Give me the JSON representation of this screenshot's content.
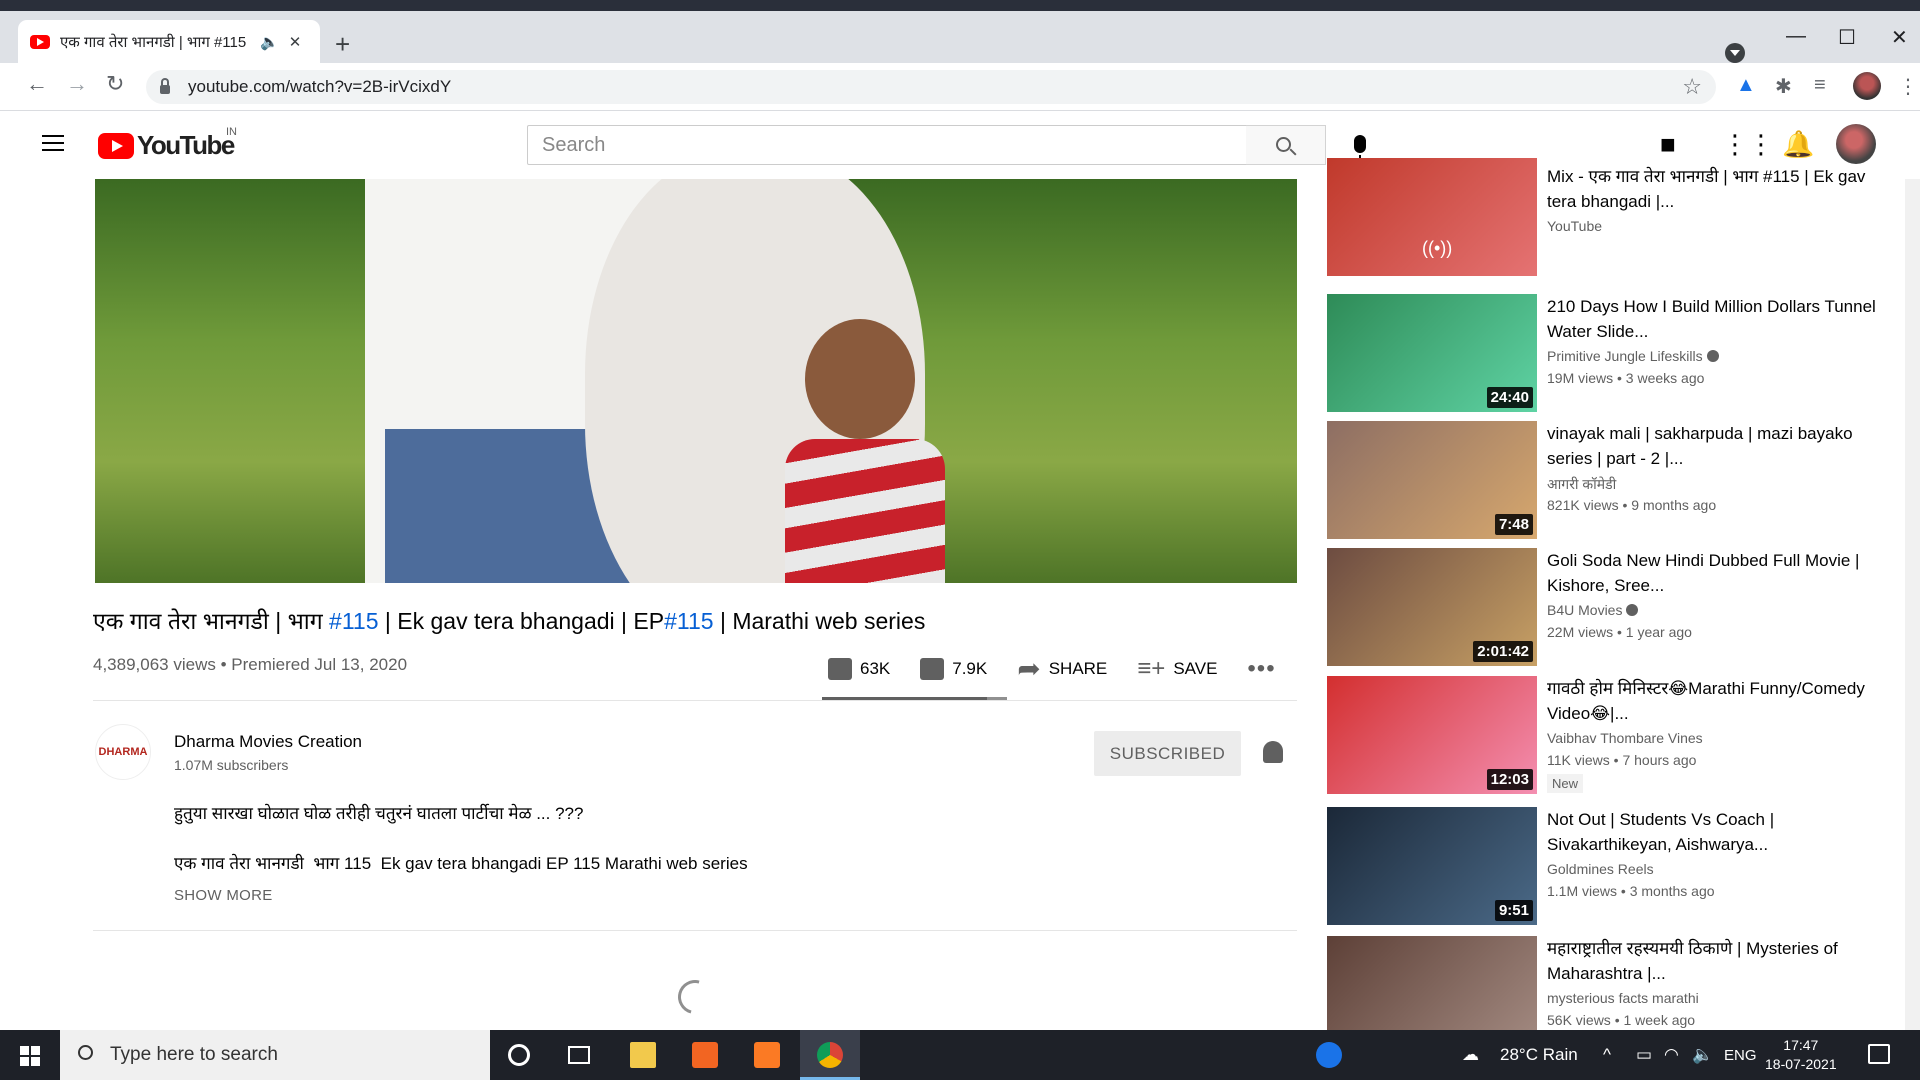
{
  "browser": {
    "tab_title": "एक गाव तेरा भानगडी | भाग #115",
    "url": "youtube.com/watch?v=2B-irVcixdY"
  },
  "youtube": {
    "logo_text": "YouTube",
    "country_code": "IN",
    "search_placeholder": "Search"
  },
  "video": {
    "title_part1": "एक गाव तेरा भानगडी | भाग ",
    "title_tag1": "#115",
    "title_part2": " | Ek gav tera bhangadi | EP",
    "title_tag2": "#115",
    "title_part3": " | Marathi web series",
    "views_date": "4,389,063 views • Premiered Jul 13, 2020",
    "likes": "63K",
    "dislikes": "7.9K",
    "share_label": "SHARE",
    "save_label": "SAVE",
    "like_ratio": 0.89
  },
  "channel": {
    "name": "Dharma Movies Creation",
    "subscribers": "1.07M subscribers",
    "subscribe_label": "SUBSCRIBED",
    "avatar_text": "DHARMA"
  },
  "description": {
    "line1": "हुतुया सारखा घोळात घोळ तरीही चतुरनं घातला पार्टीचा मेळ ... ???",
    "line2": "एक गाव तेरा भानगडी  भाग 115  Ek gav tera bhangadi EP 115 Marathi web series",
    "show_more": "SHOW MORE"
  },
  "recommendations": [
    {
      "title": "Mix - एक गाव तेरा भानगडी | भाग #115 | Ek gav tera bhangadi |...",
      "channel": "YouTube",
      "stats": "",
      "duration": "",
      "verified": false,
      "new": false
    },
    {
      "title": "210 Days How I Build Million Dollars Tunnel Water Slide...",
      "channel": "Primitive Jungle Lifeskills",
      "stats": "19M views • 3 weeks ago",
      "duration": "24:40",
      "verified": true,
      "new": false
    },
    {
      "title": "vinayak mali | sakharpuda | mazi bayako series | part - 2 |...",
      "channel": "आगरी कॉमेडी",
      "stats": "821K views • 9 months ago",
      "duration": "7:48",
      "verified": false,
      "new": false
    },
    {
      "title": "Goli Soda New Hindi Dubbed Full Movie | Kishore, Sree...",
      "channel": "B4U Movies",
      "stats": "22M views • 1 year ago",
      "duration": "2:01:42",
      "verified": true,
      "new": false
    },
    {
      "title": "गावठी होम मिनिस्टर😂Marathi Funny/Comedy Video😂|...",
      "channel": "Vaibhav Thombare Vines",
      "stats": "11K views • 7 hours ago",
      "duration": "12:03",
      "verified": false,
      "new": true,
      "new_label": "New"
    },
    {
      "title": "Not Out | Students Vs Coach | Sivakarthikeyan, Aishwarya...",
      "channel": "Goldmines Reels",
      "stats": "1.1M views • 3 months ago",
      "duration": "9:51",
      "verified": false,
      "new": false
    },
    {
      "title": "महाराष्ट्रातील रहस्यमयी ठिकाणे | Mysteries of Maharashtra |...",
      "channel": "mysterious facts marathi",
      "stats": "56K views • 1 week ago",
      "duration": "",
      "verified": false,
      "new": false
    }
  ],
  "taskbar": {
    "search_placeholder": "Type here to search",
    "weather": "28°C  Rain",
    "language": "ENG",
    "time": "17:47",
    "date": "18-07-2021"
  },
  "colors": {
    "youtube_red": "#ff0000",
    "link_blue": "#065fd4",
    "taskbar": "#1e2128"
  }
}
